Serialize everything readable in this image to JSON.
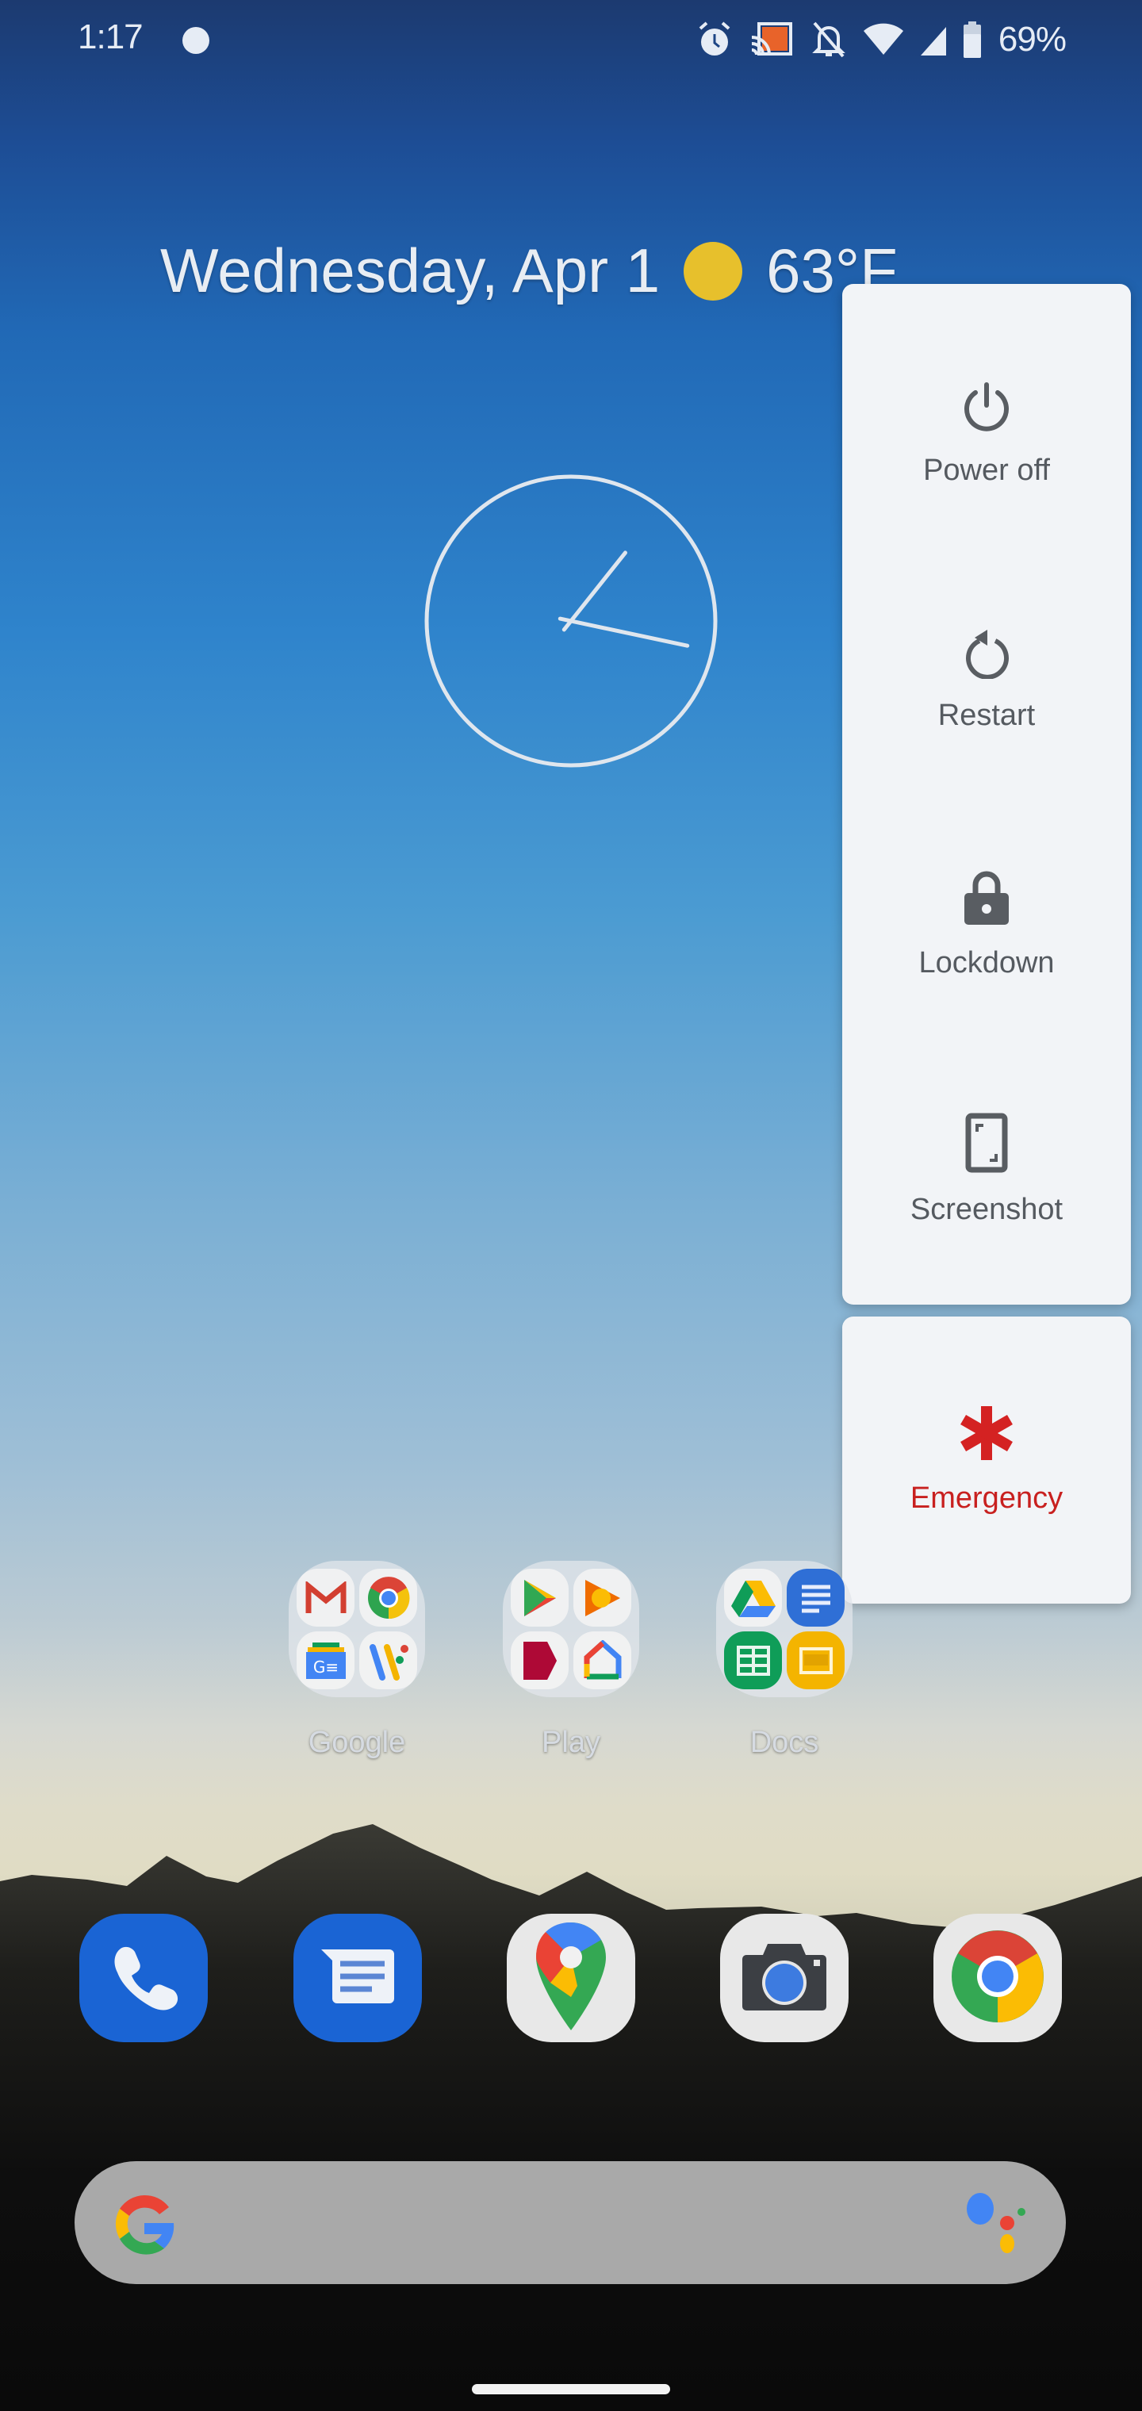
{
  "status_bar": {
    "time": "1:17",
    "icons": [
      "notification-dot-icon",
      "alarm-icon",
      "cast-icon",
      "notifications-off-icon",
      "wifi-icon",
      "cellular-signal-icon",
      "battery-icon"
    ],
    "battery_percent": "69%",
    "cast_color": "#e8632a"
  },
  "at_a_glance": {
    "date": "Wednesday, Apr 1",
    "weather_icon": "sunny-icon",
    "temperature": "63°F",
    "sun_color": "#e7c02c"
  },
  "clock_widget": {
    "time": "1:17",
    "hours": 1,
    "minutes": 17
  },
  "power_menu": {
    "items": [
      {
        "id": "power-off",
        "label": "Power off",
        "icon": "power-icon"
      },
      {
        "id": "restart",
        "label": "Restart",
        "icon": "restart-icon"
      },
      {
        "id": "lockdown",
        "label": "Lockdown",
        "icon": "lock-icon"
      },
      {
        "id": "screenshot",
        "label": "Screenshot",
        "icon": "screenshot-icon"
      }
    ],
    "emergency": {
      "label": "Emergency",
      "icon": "emergency-asterisk-icon",
      "color": "#c8201f"
    }
  },
  "folders": [
    {
      "label": "Google",
      "apps": [
        "Gmail",
        "Chrome",
        "Google News",
        "Google Pay"
      ]
    },
    {
      "label": "Play",
      "apps": [
        "Play Store",
        "Play Music",
        "Play Movies & TV",
        "Google Home"
      ]
    },
    {
      "label": "Docs",
      "apps": [
        "Drive",
        "Docs",
        "Sheets",
        "Slides"
      ]
    }
  ],
  "dock": [
    {
      "app": "Phone",
      "icon": "phone-icon"
    },
    {
      "app": "Messages",
      "icon": "messages-icon"
    },
    {
      "app": "Maps",
      "icon": "maps-pin-icon"
    },
    {
      "app": "Camera",
      "icon": "camera-icon"
    },
    {
      "app": "Chrome",
      "icon": "chrome-icon"
    }
  ],
  "search_bar": {
    "left_icon": "google-g-icon",
    "right_icon": "google-assistant-icon"
  }
}
